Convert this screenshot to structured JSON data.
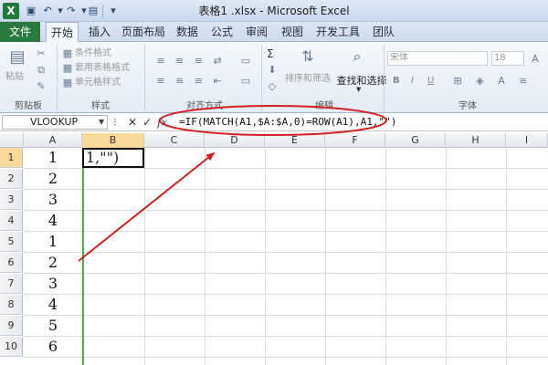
{
  "titlebar": {
    "app_icon": "X",
    "save_icon": "save-icon",
    "undo_icon": "undo-icon",
    "redo_icon": "redo-icon",
    "title": "表格1 .xlsx - Microsoft Excel"
  },
  "tabs": [
    "文件",
    "开始",
    "插入",
    "页面布局",
    "数据",
    "公式",
    "审阅",
    "视图",
    "开发工具",
    "团队"
  ],
  "ribbon": {
    "paste_label": "粘贴",
    "clipboard_label": "剪贴板",
    "cond_format": "条件格式",
    "table_format": "套用表格格式",
    "cell_style": "单元格样式",
    "styles_label": "样式",
    "alignment_label": "对齐方式",
    "sum_symbol": "Σ",
    "sort_filter": "排序和筛选",
    "find_select": "查找和选择",
    "editing_label": "编辑",
    "font_name": "宋体",
    "font_size": "18",
    "font_label": "字体",
    "bold": "B",
    "italic": "I",
    "underline": "U"
  },
  "formula_bar": {
    "name_box": "VLOOKUP",
    "cancel": "✕",
    "enter": "✓",
    "fx": "fx",
    "formula": "=IF(MATCH(A1,$A:$A,0)=ROW(A1),A1,\"\")"
  },
  "grid": {
    "columns": [
      "A",
      "B",
      "C",
      "D",
      "E",
      "F",
      "G",
      "H",
      "I"
    ],
    "rows": [
      "1",
      "2",
      "3",
      "4",
      "5",
      "6",
      "7",
      "8",
      "9",
      "10"
    ],
    "column_a_values": [
      "1",
      "2",
      "3",
      "4",
      "1",
      "2",
      "3",
      "4",
      "5",
      "6"
    ],
    "active_cell_text": "1,\"\")"
  },
  "annotation_color": "#d42020"
}
